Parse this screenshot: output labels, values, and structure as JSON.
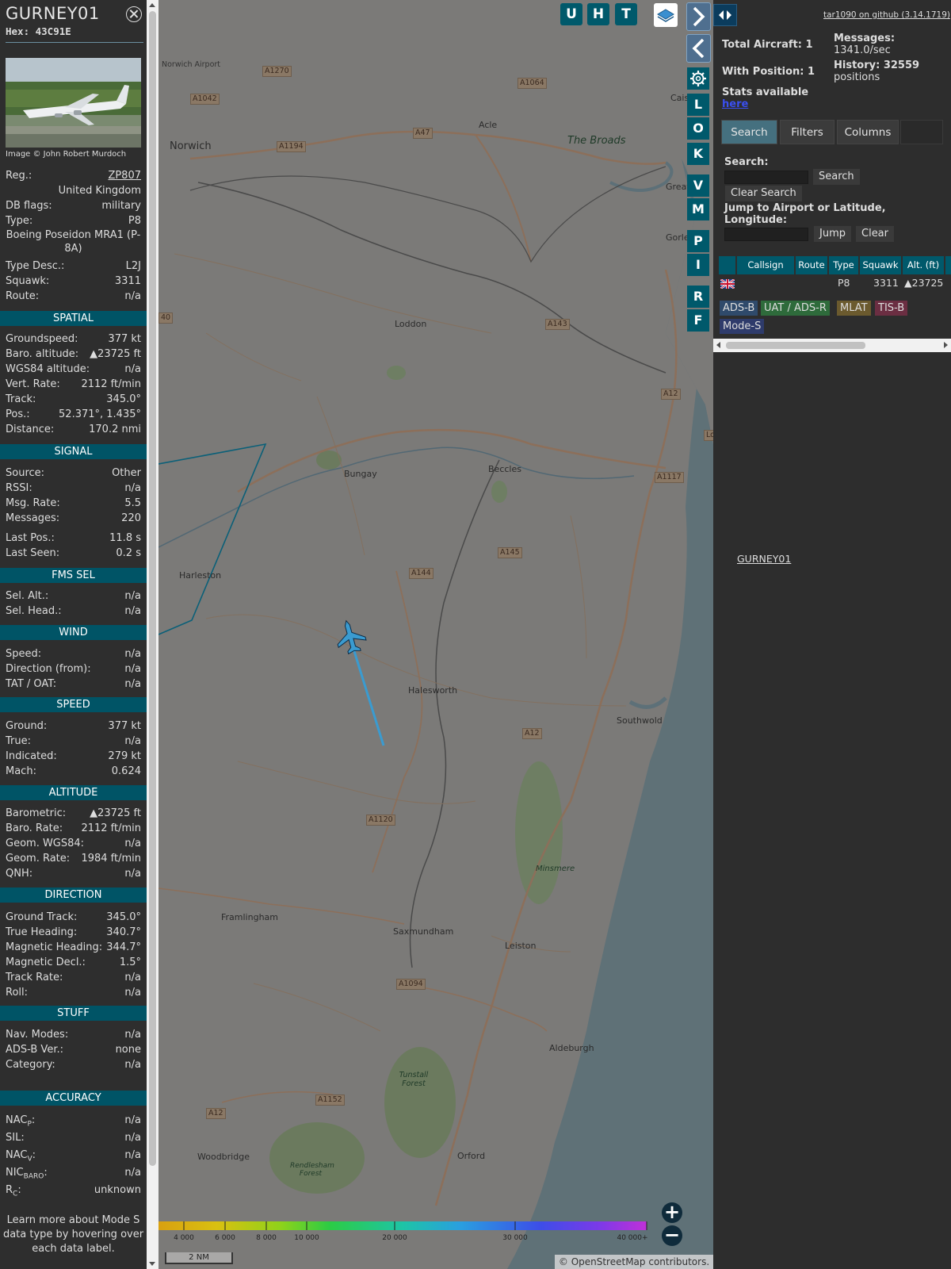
{
  "aircraft": {
    "callsign": "GURNEY01",
    "hex": "Hex: 43C91E",
    "photo_credit": "Image © John Robert Murdoch",
    "info": [
      {
        "label": "Reg.:",
        "value": "ZP807"
      },
      {
        "label": "",
        "value": "United Kingdom"
      },
      {
        "label": "DB flags:",
        "value": "military"
      },
      {
        "label": "Type:",
        "value": "P8"
      },
      {
        "label": "",
        "value": "Boeing Poseidon MRA1 (P-8A)"
      },
      {
        "label": "Type Desc.:",
        "value": "L2J"
      },
      {
        "label": "Squawk:",
        "value": "3311"
      },
      {
        "label": "Route:",
        "value": "n/a"
      }
    ],
    "spatial_title": "SPATIAL",
    "spatial": [
      {
        "label": "Groundspeed:",
        "value": "377 kt"
      },
      {
        "label": "Baro. altitude:",
        "value": "▲23725 ft"
      },
      {
        "label": "WGS84 altitude:",
        "value": "n/a"
      },
      {
        "label": "Vert. Rate:",
        "value": "2112 ft/min"
      },
      {
        "label": "Track:",
        "value": "345.0°"
      },
      {
        "label": "Pos.:",
        "value": "52.371°, 1.435°"
      },
      {
        "label": "Distance:",
        "value": "170.2 nmi"
      }
    ],
    "signal_title": "SIGNAL",
    "signal": [
      {
        "label": "Source:",
        "value": "Other"
      },
      {
        "label": "RSSI:",
        "value": "n/a"
      },
      {
        "label": "Msg. Rate:",
        "value": "5.5"
      },
      {
        "label": "Messages:",
        "value": "220"
      },
      {
        "label": "Last Pos.:",
        "value": "11.8 s"
      },
      {
        "label": "Last Seen:",
        "value": "0.2 s"
      }
    ],
    "fms_title": "FMS SEL",
    "fms": [
      {
        "label": "Sel. Alt.:",
        "value": "n/a"
      },
      {
        "label": "Sel. Head.:",
        "value": "n/a"
      }
    ],
    "wind_title": "WIND",
    "wind": [
      {
        "label": "Speed:",
        "value": "n/a"
      },
      {
        "label": "Direction (from):",
        "value": "n/a"
      },
      {
        "label": "TAT / OAT:",
        "value": "n/a"
      }
    ],
    "speed_title": "SPEED",
    "speed": [
      {
        "label": "Ground:",
        "value": "377 kt"
      },
      {
        "label": "True:",
        "value": "n/a"
      },
      {
        "label": "Indicated:",
        "value": "279 kt"
      },
      {
        "label": "Mach:",
        "value": "0.624"
      }
    ],
    "altitude_title": "ALTITUDE",
    "altitude": [
      {
        "label": "Barometric:",
        "value": "▲23725 ft"
      },
      {
        "label": "Baro. Rate:",
        "value": "2112 ft/min"
      },
      {
        "label": "Geom. WGS84:",
        "value": "n/a"
      },
      {
        "label": "Geom. Rate:",
        "value": "1984 ft/min"
      },
      {
        "label": "QNH:",
        "value": "n/a"
      }
    ],
    "direction_title": "DIRECTION",
    "direction": [
      {
        "label": "Ground Track:",
        "value": "345.0°"
      },
      {
        "label": "True Heading:",
        "value": "340.7°"
      },
      {
        "label": "Magnetic Heading:",
        "value": "344.7°"
      },
      {
        "label": "Magnetic Decl.:",
        "value": "1.5°"
      },
      {
        "label": "Track Rate:",
        "value": "n/a"
      },
      {
        "label": "Roll:",
        "value": "n/a"
      }
    ],
    "stuff_title": "STUFF",
    "stuff": [
      {
        "label": "Nav. Modes:",
        "value": "n/a"
      },
      {
        "label": "ADS-B Ver.:",
        "value": "none"
      },
      {
        "label": "Category:",
        "value": "n/a"
      }
    ],
    "accuracy_title": "ACCURACY",
    "accuracy": [
      {
        "label": "NACP:",
        "main": "NAC",
        "sub": "P",
        "value": "n/a"
      },
      {
        "label": "SIL:",
        "main": "SIL",
        "sub": "",
        "value": "n/a"
      },
      {
        "label": "NACV:",
        "main": "NAC",
        "sub": "V",
        "value": "n/a"
      },
      {
        "label": "NICBARO:",
        "main": "NIC",
        "sub": "BARO",
        "value": "n/a"
      },
      {
        "label": "RC:",
        "main": "R",
        "sub": "C",
        "value": "unknown"
      }
    ],
    "footnote": "Learn more about Mode S data type by hovering over each data label."
  },
  "map": {
    "buttons": [
      "U",
      "H",
      "T"
    ],
    "side_buttons": [
      "L",
      "O",
      "K",
      "V",
      "M",
      "P",
      "I",
      "R",
      "F"
    ],
    "places": [
      "Norwich",
      "Norwich Airport",
      "Acle",
      "The Broads",
      "Great",
      "Gorle",
      "Caist",
      "Loddon",
      "Bungay",
      "Beccles",
      "Harleston",
      "Halesworth",
      "Southwold",
      "Minsmere",
      "Framlingham",
      "Saxmundham",
      "Leiston",
      "Aldeburgh",
      "Tunstall Forest",
      "Woodbridge",
      "Rendlesham Forest",
      "Orford"
    ],
    "roads": [
      "A1270",
      "A1064",
      "A1042",
      "A47",
      "A1194",
      "A143",
      "A12",
      "A1117",
      "A145",
      "A144",
      "A12",
      "A1120",
      "A1094",
      "A1152",
      "A12",
      "40",
      "Lo",
      "S"
    ],
    "altitude_scale": [
      "4 000",
      "6 000",
      "8 000",
      "10 000",
      "20 000",
      "30 000",
      "40 000+"
    ],
    "scale_label": "2 NM",
    "attribution_prefix": "© ",
    "attribution_link": "OpenStreetMap",
    "attribution_suffix": " contributors."
  },
  "panel": {
    "github_link": "tar1090 on github (3.14.1719)",
    "total_aircraft": "Total Aircraft: 1",
    "with_position": "With Position: 1",
    "messages_label": "Messages:",
    "messages_value": "1341.0/sec",
    "history_label": "History: 32559",
    "history_value": "positions",
    "stats_label": "Stats available",
    "stats_link": "here",
    "tabs": [
      "Search",
      "Filters",
      "Columns"
    ],
    "search_label": "Search:",
    "search_button": "Search",
    "clear_search_button": "Clear Search",
    "jump_label": "Jump to Airport or Latitude, Longitude:",
    "jump_button": "Jump",
    "clear_button": "Clear",
    "table_headers": [
      "Callsign",
      "Route",
      "Type",
      "Squawk",
      "Alt. (ft)"
    ],
    "table_rows": [
      {
        "callsign": "GURNEY01",
        "route": "",
        "type": "P8",
        "squawk": "3311",
        "alt": "▲23725"
      }
    ],
    "legend": [
      "ADS-B",
      "UAT / ADS-R",
      "MLAT",
      "TIS-B",
      "Mode-S"
    ],
    "colors": {
      "teal": "#00596b",
      "adsb": "#2f4a6b",
      "uat": "#2e6b3b",
      "mlat": "#6b5a2e",
      "tisb": "#6b2e42",
      "modes": "#2e3b6b"
    }
  }
}
